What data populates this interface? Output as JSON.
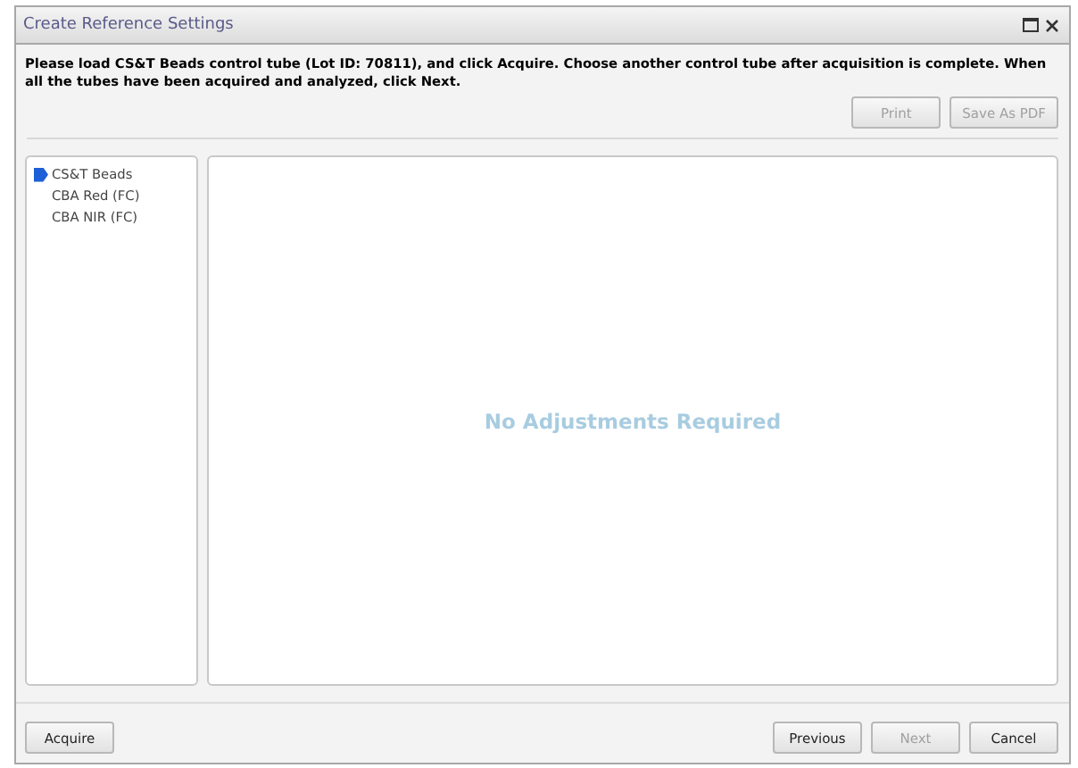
{
  "window": {
    "title": "Create Reference Settings"
  },
  "instructions": "Please load CS&T Beads control tube (Lot ID: 70811), and click Acquire. Choose another control tube after acquisition is complete. When all the tubes have been acquired and analyzed, click Next.",
  "report_buttons": [
    {
      "label": "Print",
      "disabled": true
    },
    {
      "label": "Save As PDF",
      "disabled": true
    }
  ],
  "tubes": [
    {
      "label": "CS&T Beads",
      "selected": true
    },
    {
      "label": "CBA Red (FC)",
      "selected": false
    },
    {
      "label": "CBA NIR (FC)",
      "selected": false
    }
  ],
  "message": "No Adjustments Required",
  "footer": {
    "left": [
      {
        "label": "Acquire",
        "disabled": false
      }
    ],
    "right": [
      {
        "label": "Previous",
        "disabled": false
      },
      {
        "label": "Next",
        "disabled": true
      },
      {
        "label": "Cancel",
        "disabled": false
      }
    ]
  }
}
